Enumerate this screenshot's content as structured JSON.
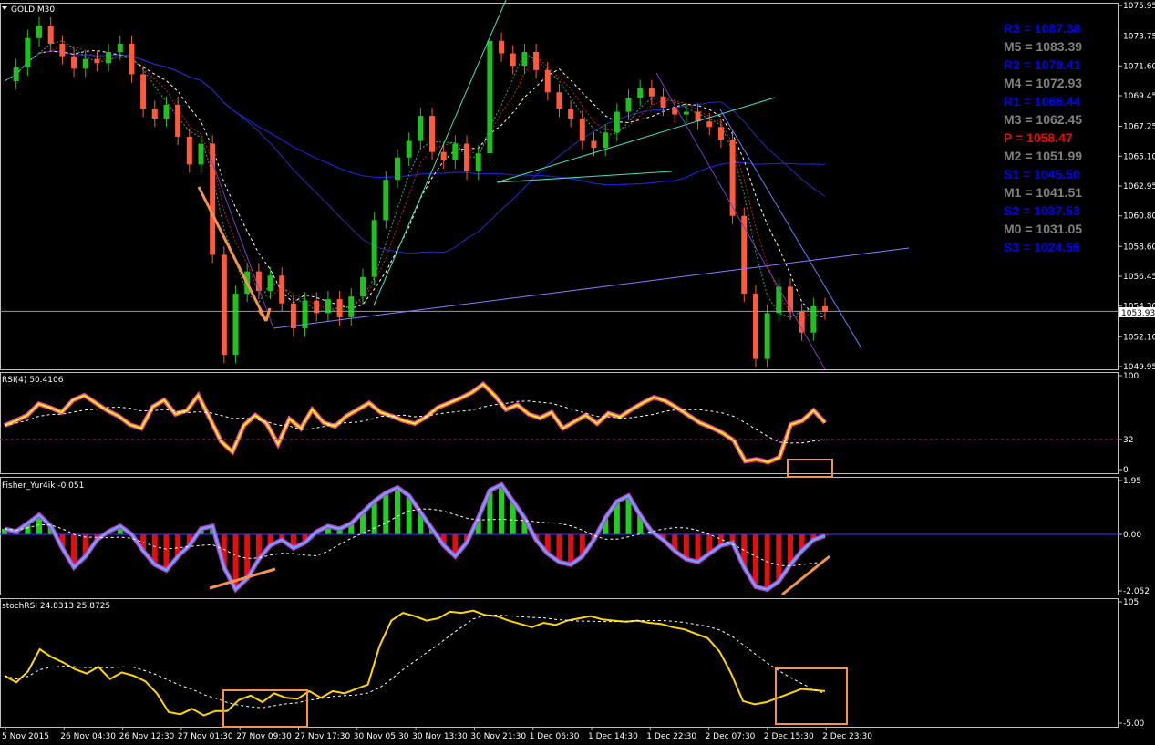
{
  "chart_data": {
    "type": "candlestick",
    "symbol_label": "GOLD,M30",
    "current_price": "1053.93",
    "price_axis_ticks": [
      "1075.95",
      "1073.75",
      "1071.60",
      "1069.45",
      "1067.25",
      "1065.10",
      "1062.95",
      "1060.80",
      "1058.60",
      "1056.45",
      "1054.30",
      "1052.10",
      "1049.95"
    ],
    "price_range": [
      1049.95,
      1075.95
    ],
    "price_path": [
      1070.5,
      1071.5,
      1073.6,
      1074.5,
      1073.2,
      1072.3,
      1071.4,
      1072.1,
      1071.8,
      1072.6,
      1073.2,
      1071.0,
      1068.5,
      1067.8,
      1068.8,
      1066.5,
      1064.5,
      1066.0,
      1058.0,
      1050.8,
      1055.2,
      1056.8,
      1055.4,
      1056.5,
      1054.5,
      1052.7,
      1054.7,
      1053.8,
      1054.8,
      1053.5,
      1055.0,
      1056.4,
      1060.5,
      1063.4,
      1065.0,
      1066.2,
      1068.0,
      1065.4,
      1064.8,
      1066.0,
      1064.0,
      1065.3,
      1073.4,
      1072.5,
      1071.6,
      1072.6,
      1071.3,
      1069.7,
      1068.5,
      1067.8,
      1066.2,
      1065.7,
      1066.8,
      1068.3,
      1069.3,
      1070.0,
      1069.4,
      1068.6,
      1068.1,
      1068.3,
      1067.6,
      1067.2,
      1066.3,
      1060.8,
      1055.2,
      1050.5,
      1053.8,
      1055.7,
      1053.9,
      1052.4,
      1054.3,
      1053.93
    ],
    "pivot_levels": [
      {
        "label": "R3 = 1087.38",
        "color": "#0000ff"
      },
      {
        "label": "M5 = 1083.39",
        "color": "#808080"
      },
      {
        "label": "R2 = 1079.41",
        "color": "#0000ff"
      },
      {
        "label": "M4 = 1072.93",
        "color": "#808080"
      },
      {
        "label": "R1 = 1066.44",
        "color": "#0000ff"
      },
      {
        "label": "M3 = 1062.45",
        "color": "#808080"
      },
      {
        "label": "P  = 1058.47",
        "color": "#ff0000"
      },
      {
        "label": "M2 = 1051.99",
        "color": "#808080"
      },
      {
        "label": "S1 = 1045.50",
        "color": "#0000ff"
      },
      {
        "label": "M1 = 1041.51",
        "color": "#808080"
      },
      {
        "label": "S2 = 1037.53",
        "color": "#0000ff"
      },
      {
        "label": "M0 = 1031.05",
        "color": "#808080"
      },
      {
        "label": "S3 = 1024.56",
        "color": "#0000ff"
      }
    ],
    "x_tick_labels": [
      "5 Nov 2015",
      "26 Nov 04:30",
      "26 Nov 12:30",
      "27 Nov 01:30",
      "27 Nov 09:30",
      "27 Nov 17:30",
      "30 Nov 05:30",
      "30 Nov 13:30",
      "30 Nov 21:30",
      "1 Dec 06:30",
      "1 Dec 14:30",
      "1 Dec 22:30",
      "2 Dec 07:30",
      "2 Dec 15:30",
      "2 Dec 23:30"
    ],
    "indicators": [
      {
        "name": "RSI",
        "label": "RSI(4) 50.4106",
        "ticks": [
          "100",
          "32",
          "0"
        ],
        "level": 32,
        "values": [
          47,
          52,
          58,
          70,
          66,
          61,
          74,
          79,
          71,
          63,
          57,
          48,
          44,
          67,
          74,
          59,
          63,
          79,
          55,
          30,
          19,
          47,
          58,
          49,
          27,
          54,
          44,
          64,
          50,
          46,
          57,
          64,
          71,
          61,
          57,
          52,
          49,
          56,
          66,
          71,
          76,
          82,
          91,
          79,
          64,
          69,
          59,
          55,
          61,
          44,
          51,
          58,
          49,
          60,
          56,
          64,
          71,
          77,
          73,
          66,
          58,
          50,
          45,
          39,
          31,
          9,
          11,
          8,
          13,
          48,
          52,
          63,
          50
        ]
      },
      {
        "name": "Fisher",
        "label": "Fisher_Yur4ik -0.051",
        "ticks": [
          "1.95",
          "0.00",
          "-2.052"
        ],
        "values": [
          0.2,
          0.1,
          0.4,
          0.7,
          0.3,
          -0.5,
          -1.2,
          -0.8,
          -0.2,
          0.1,
          0.3,
          0.0,
          -0.6,
          -1.1,
          -1.3,
          -0.8,
          -0.4,
          0.2,
          0.3,
          -1.2,
          -2.0,
          -1.6,
          -0.9,
          -0.4,
          -0.2,
          -0.5,
          -0.3,
          0.1,
          0.3,
          0.2,
          0.4,
          0.8,
          1.2,
          1.5,
          1.7,
          1.4,
          0.8,
          0.2,
          -0.4,
          -0.8,
          -0.3,
          0.6,
          1.6,
          1.8,
          1.2,
          0.6,
          -0.2,
          -0.7,
          -1.0,
          -1.1,
          -0.8,
          -0.2,
          0.6,
          1.2,
          1.4,
          0.7,
          0.1,
          -0.2,
          -0.6,
          -0.9,
          -1.0,
          -0.7,
          -0.4,
          -0.3,
          -1.2,
          -1.9,
          -2.0,
          -1.7,
          -1.1,
          -0.6,
          -0.2,
          -0.05
        ]
      },
      {
        "name": "stochRSI",
        "label": "stochRSI 24.8313 25.8725",
        "ticks": [
          "105",
          "-5.00"
        ],
        "values": [
          38,
          32,
          42,
          62,
          55,
          50,
          44,
          40,
          46,
          35,
          41,
          38,
          33,
          22,
          5,
          3,
          8,
          2,
          6,
          6,
          16,
          20,
          14,
          22,
          18,
          17,
          24,
          18,
          24,
          22,
          26,
          30,
          65,
          88,
          95,
          92,
          88,
          90,
          96,
          95,
          97,
          93,
          92,
          88,
          85,
          82,
          86,
          84,
          88,
          90,
          92,
          89,
          88,
          87,
          88,
          86,
          85,
          82,
          80,
          76,
          72,
          60,
          40,
          15,
          12,
          14,
          18,
          22,
          26,
          25,
          24
        ]
      }
    ]
  }
}
